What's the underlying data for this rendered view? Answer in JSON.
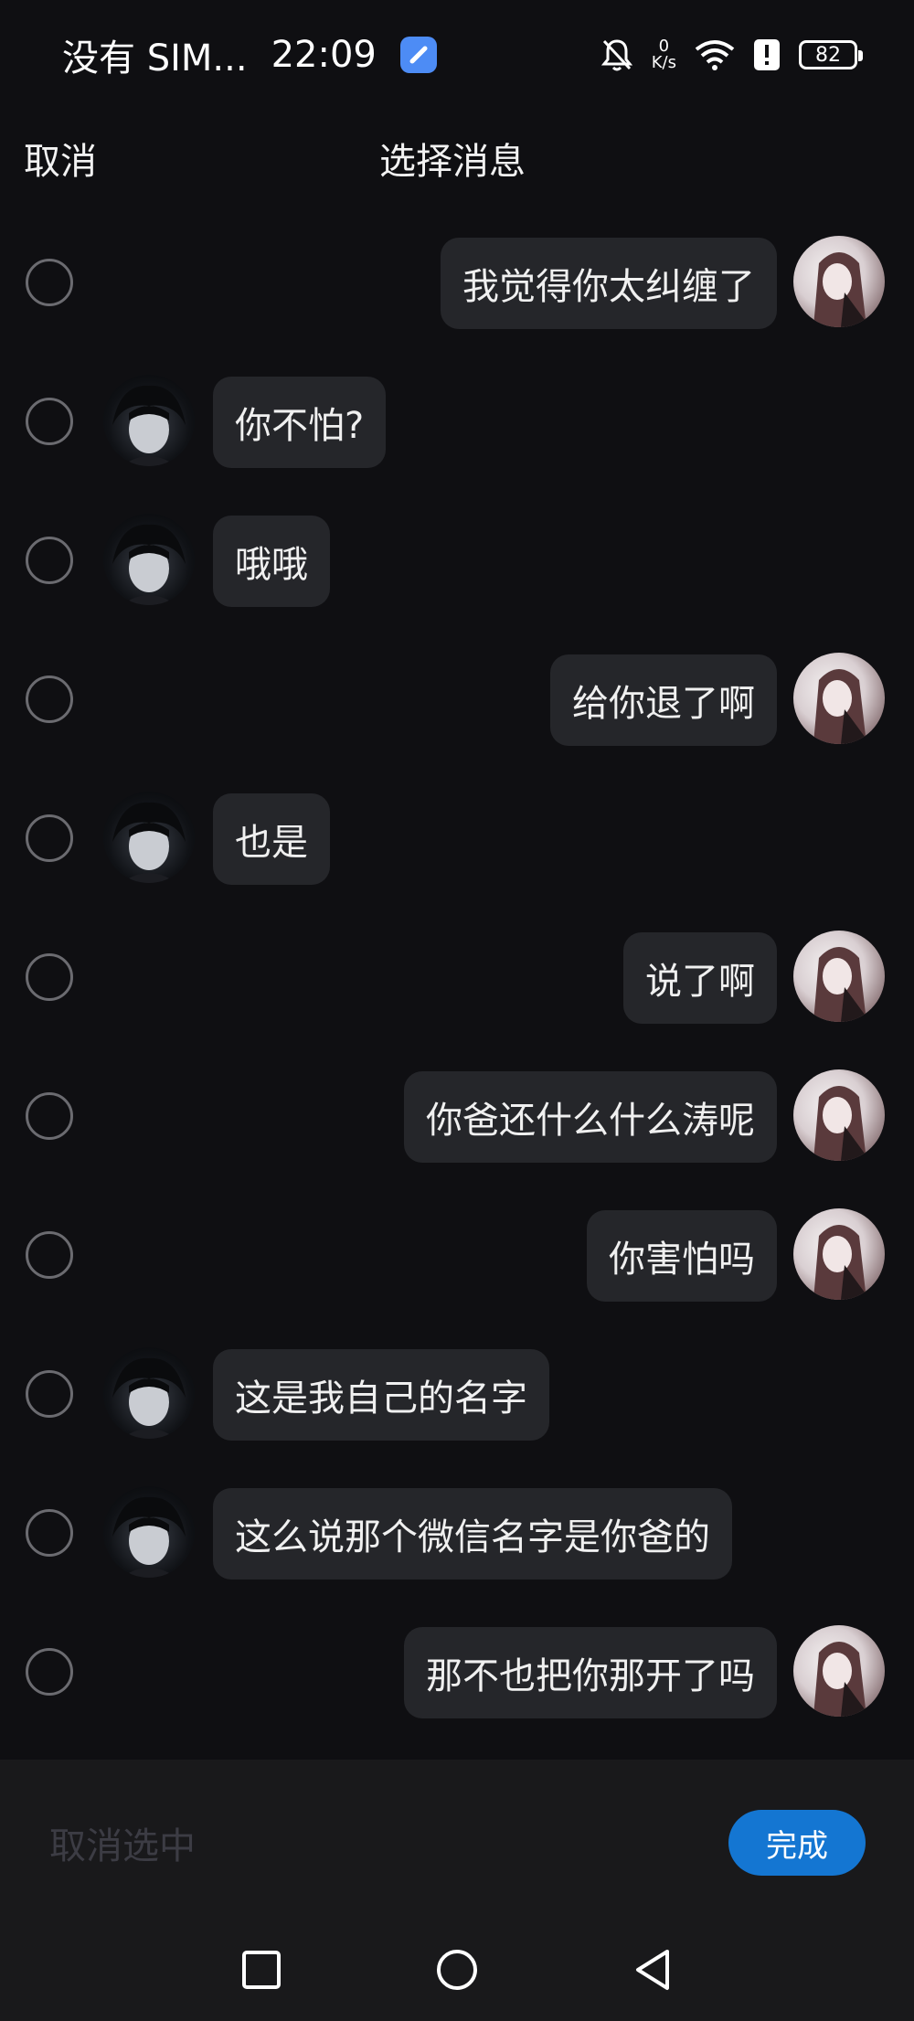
{
  "status": {
    "carrier": "没有 SIM...",
    "time": "22:09",
    "speed_value": "0",
    "speed_unit": "K/s",
    "battery": "82"
  },
  "header": {
    "cancel": "取消",
    "title": "选择消息"
  },
  "messages": [
    {
      "side": "right",
      "text": "我觉得你太纠缠了"
    },
    {
      "side": "left",
      "text": "你不怕?"
    },
    {
      "side": "left",
      "text": "哦哦"
    },
    {
      "side": "right",
      "text": "给你退了啊"
    },
    {
      "side": "left",
      "text": "也是"
    },
    {
      "side": "right",
      "text": "说了啊"
    },
    {
      "side": "right",
      "text": "你爸还什么什么涛呢"
    },
    {
      "side": "right",
      "text": "你害怕吗"
    },
    {
      "side": "left",
      "text": "这是我自己的名字"
    },
    {
      "side": "left",
      "text": "这么说那个微信名字是你爸的"
    },
    {
      "side": "right",
      "text": "那不也把你那开了吗"
    }
  ],
  "bottom": {
    "deselect": "取消选中",
    "done": "完成"
  },
  "colors": {
    "background": "#0f0f12",
    "bubble": "#25262a",
    "accent": "#1476d2"
  }
}
